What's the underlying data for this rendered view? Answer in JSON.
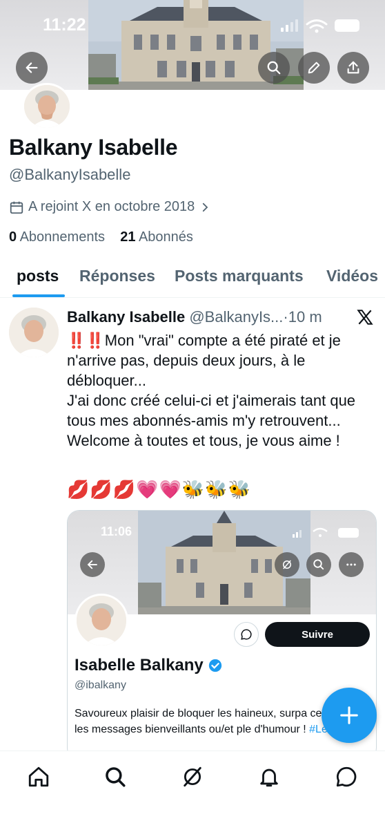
{
  "status_bar": {
    "time": "11:22"
  },
  "profile": {
    "display_name": "Balkany Isabelle",
    "handle": "@BalkanyIsabelle",
    "joined": "A rejoint X en octobre 2018",
    "following_count": "0",
    "following_label": "Abonnements",
    "followers_count": "21",
    "followers_label": "Abonnés"
  },
  "tabs": [
    {
      "label": "posts"
    },
    {
      "label": "Réponses"
    },
    {
      "label": "Posts marquants"
    },
    {
      "label": "Vidéos"
    }
  ],
  "post": {
    "author": "Balkany Isabelle",
    "handle": "@BalkanyIs...",
    "dot": "·",
    "time": "10 m",
    "lines": [
      "‼️‼️Mon \"vrai\" compte a été piraté et je n'arrive pas, depuis deux jours, à le débloquer...",
      "J'ai donc créé celui-ci et j'aimerais tant que tous mes abonnés-amis m'y retrouvent...",
      "Welcome à toutes et tous, je vous aime !"
    ],
    "emojis": "💋💋💋💗💗🐝🐝🐝",
    "embed": {
      "time": "11:06",
      "follow_label": "Suivre",
      "name": "Isabelle Balkany",
      "handle": "@ibalkany",
      "bio": "Savoureux plaisir de bloquer les haineux, surpa celui de lire les messages bienveillants ou/et ple d'humour !",
      "hashtag": "#Levallois"
    }
  },
  "colors": {
    "accent": "#1d9bf0",
    "text": "#0f1419",
    "secondary": "#536471"
  },
  "icons": [
    "back-arrow-icon",
    "search-icon",
    "edit-pencil-icon",
    "share-icon",
    "calendar-icon",
    "chevron-right-icon",
    "x-logo-icon",
    "home-icon",
    "grok-icon",
    "bell-icon",
    "messages-icon",
    "plus-icon",
    "verified-badge-icon",
    "more-icon"
  ]
}
